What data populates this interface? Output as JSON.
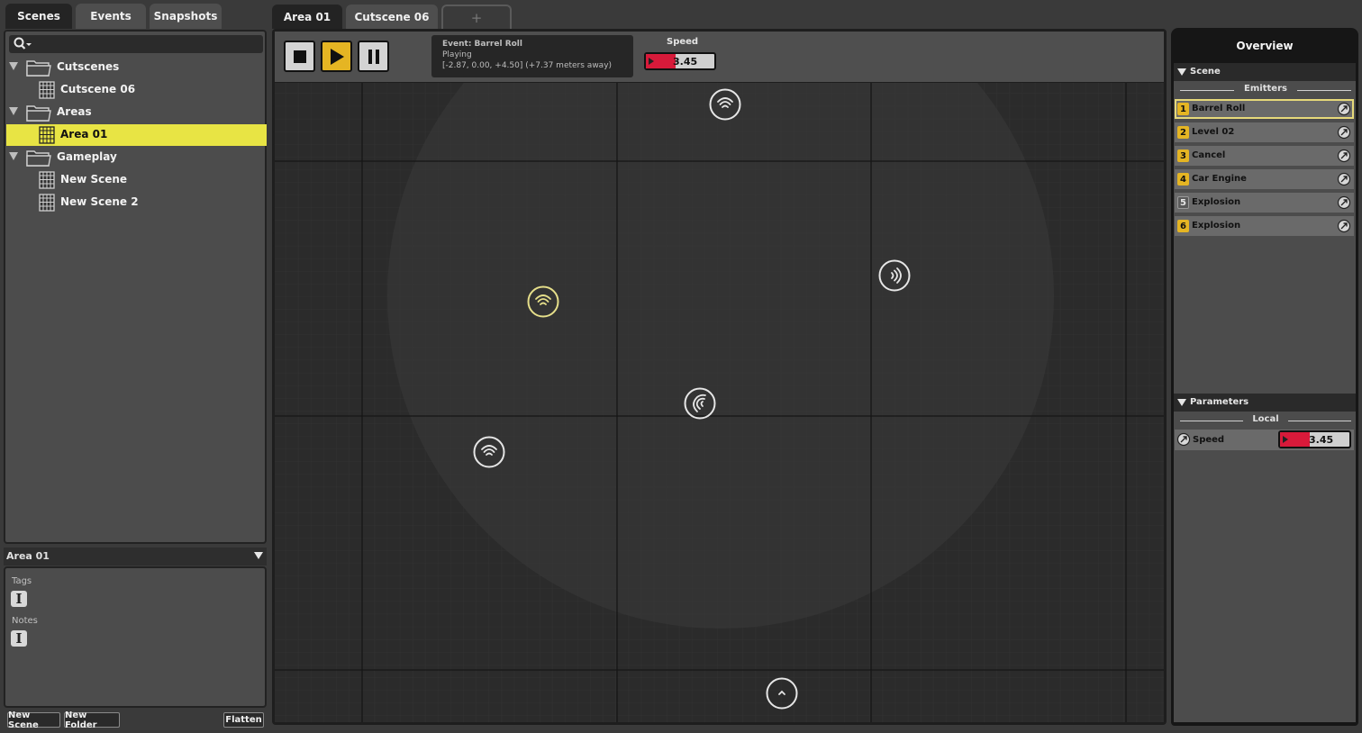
{
  "left_tabs": [
    {
      "label": "Scenes",
      "active": true
    },
    {
      "label": "Events",
      "active": false
    },
    {
      "label": "Snapshots",
      "active": false
    }
  ],
  "search": {
    "placeholder": ""
  },
  "tree": [
    {
      "label": "Cutscenes",
      "type": "folder"
    },
    {
      "label": "Cutscene 06",
      "type": "scene"
    },
    {
      "label": "Areas",
      "type": "folder"
    },
    {
      "label": "Area 01",
      "type": "scene",
      "selected": true
    },
    {
      "label": "Gameplay",
      "type": "folder"
    },
    {
      "label": "New Scene",
      "type": "scene"
    },
    {
      "label": "New Scene 2",
      "type": "scene"
    }
  ],
  "properties": {
    "title": "Area 01",
    "tags_label": "Tags",
    "notes_label": "Notes",
    "text_icon": "I"
  },
  "bottom_buttons": {
    "new_scene": "New Scene",
    "new_folder": "New Folder",
    "flatten": "Flatten"
  },
  "center_tabs": [
    {
      "label": "Area 01",
      "active": true
    },
    {
      "label": "Cutscene 06",
      "active": false
    },
    {
      "label": "+",
      "add": true
    }
  ],
  "transport": {
    "playing": true
  },
  "event_info": {
    "title": "Event: Barrel Roll",
    "status": "Playing",
    "position": "[-2.87, 0.00, +4.50] (+7.37 meters away)"
  },
  "speed": {
    "label": "Speed",
    "value": "3.45",
    "fill_fraction": 0.43
  },
  "emitter_icons": [
    {
      "name": "emitter-barrel-roll",
      "direction": "up",
      "selected": true
    },
    {
      "name": "emitter-top",
      "direction": "up"
    },
    {
      "name": "emitter-right",
      "direction": "right"
    },
    {
      "name": "emitter-center",
      "direction": "left"
    },
    {
      "name": "emitter-lower-left",
      "direction": "up"
    },
    {
      "name": "listener",
      "direction": "up"
    }
  ],
  "overview": {
    "title": "Overview",
    "scene_label": "Scene",
    "emitters_label": "Emitters",
    "emitters": [
      {
        "num": "1",
        "name": "Barrel Roll",
        "selected": true,
        "active": true
      },
      {
        "num": "2",
        "name": "Level 02",
        "active": true
      },
      {
        "num": "3",
        "name": "Cancel",
        "active": true
      },
      {
        "num": "4",
        "name": "Car Engine",
        "active": true
      },
      {
        "num": "5",
        "name": "Explosion",
        "active": false
      },
      {
        "num": "6",
        "name": "Explosion",
        "active": true
      }
    ],
    "parameters_label": "Parameters",
    "local_label": "Local",
    "param": {
      "name": "Speed",
      "value": "3.45",
      "fill_fraction": 0.43
    }
  },
  "colors": {
    "accent": "#e5b523",
    "selection": "#e8e444",
    "speed_fill": "#d81a3a"
  }
}
